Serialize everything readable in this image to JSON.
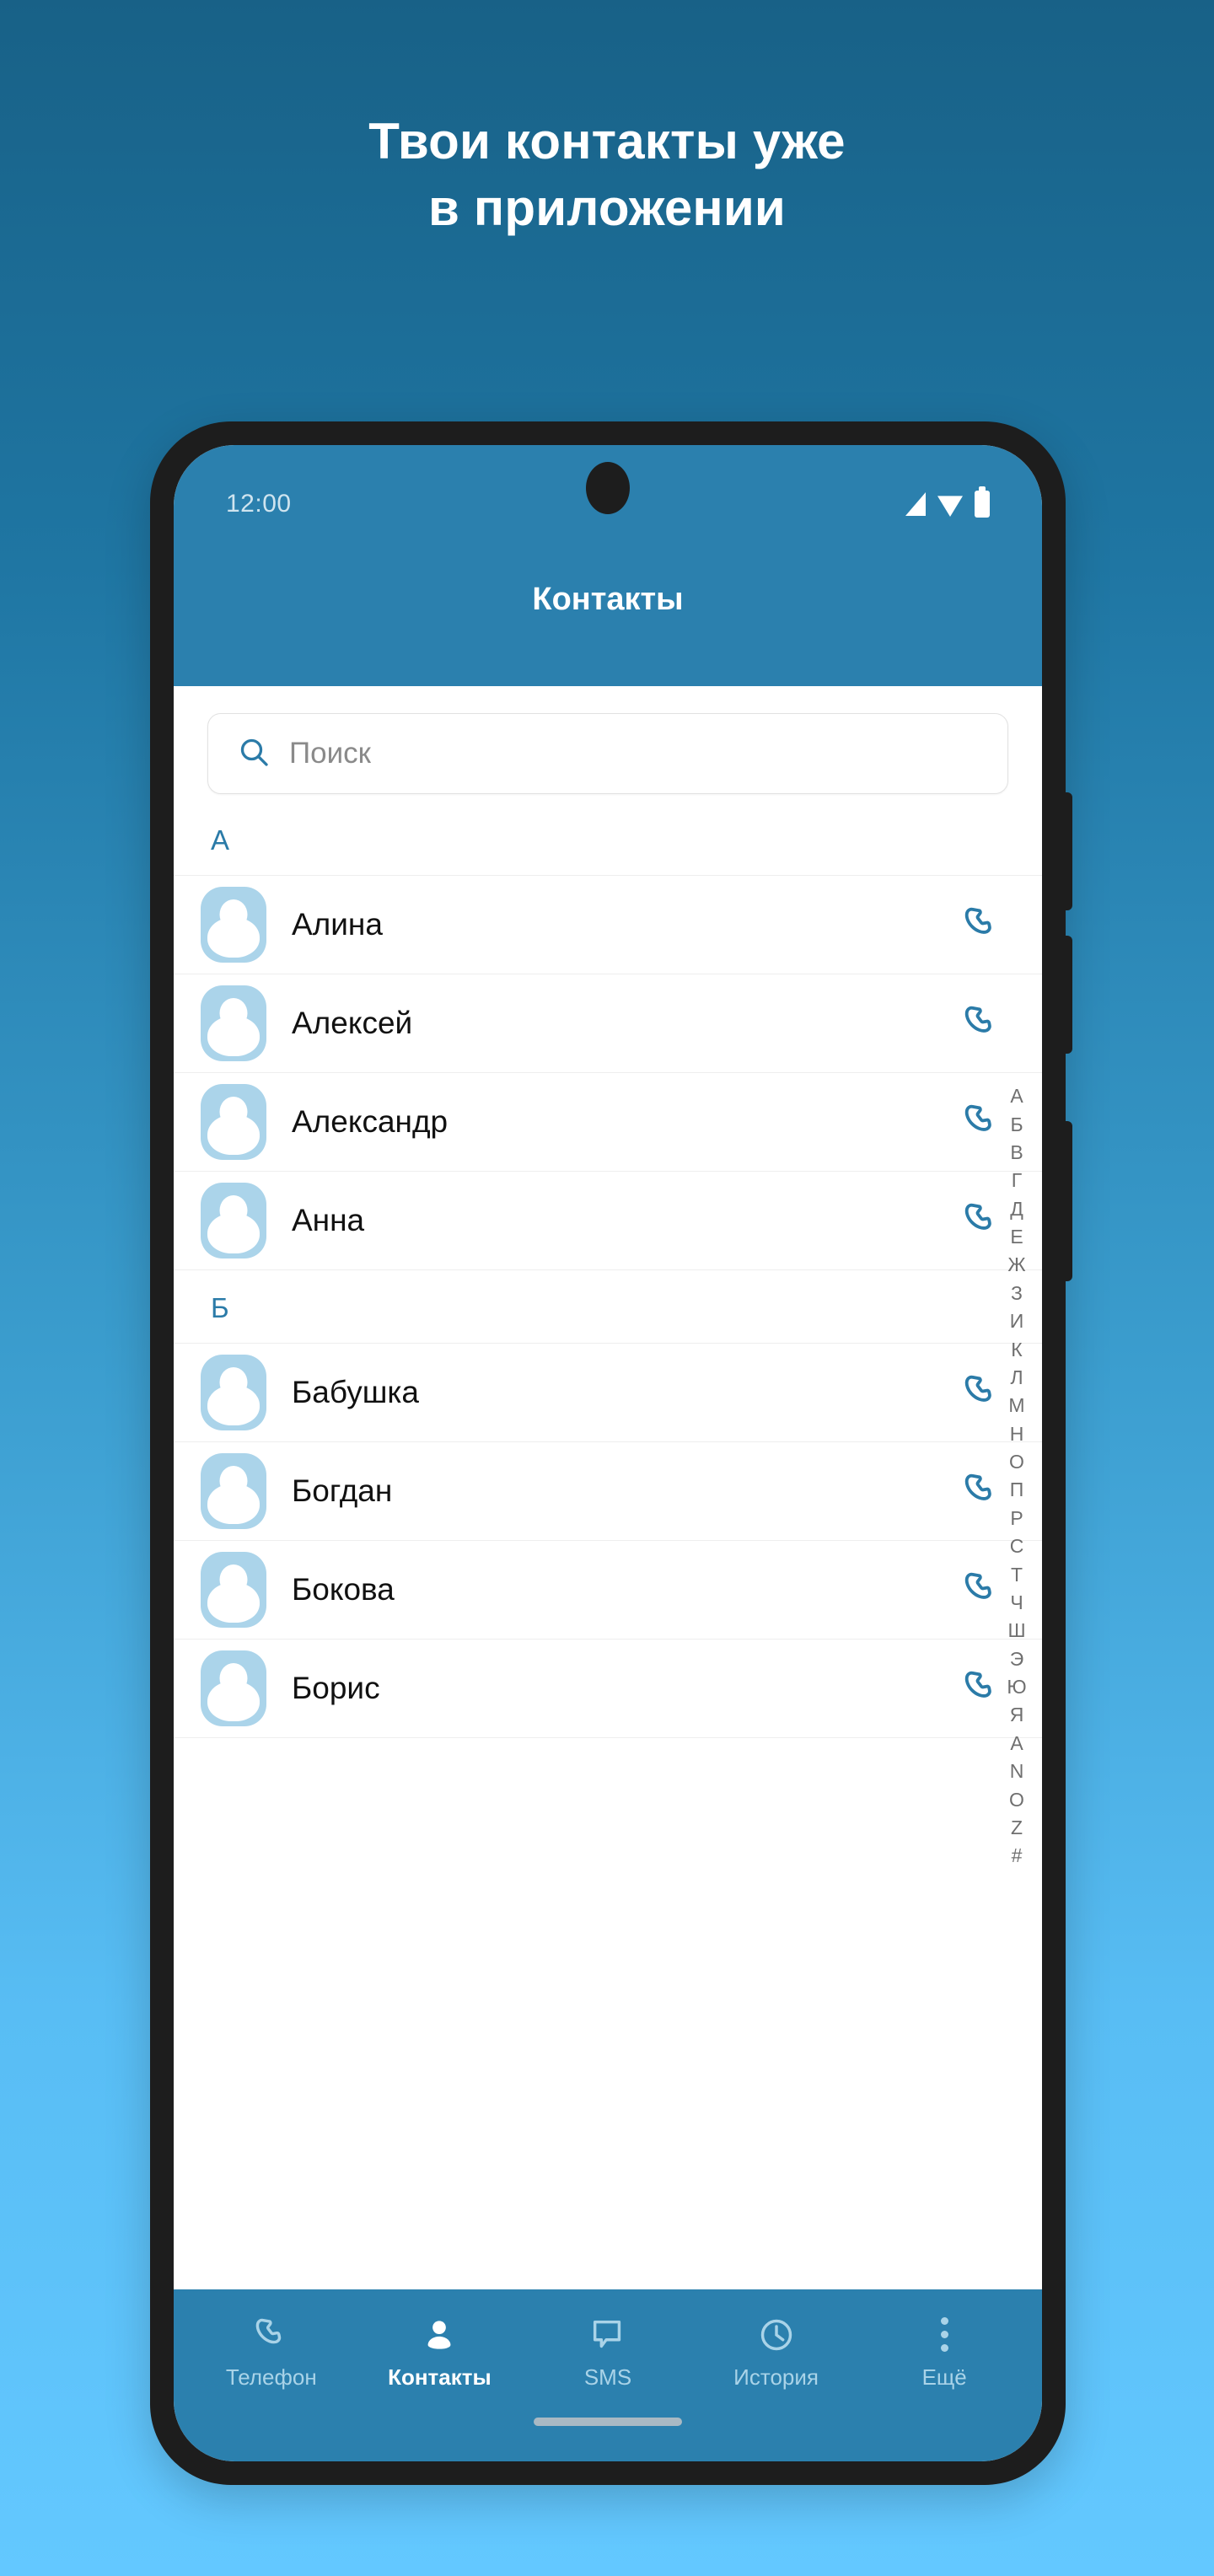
{
  "promo": {
    "line1": "Твои контакты уже",
    "line2": "в приложении"
  },
  "colors": {
    "brand_blue": "#2b80ae",
    "accent_blue": "#2b7ba8",
    "avatar_blue": "#abd4ea",
    "bg_top": "#186187",
    "bg_bottom": "#63c8ff"
  },
  "phone": {
    "status_bar": {
      "time": "12:00",
      "icons": [
        "signal-icon",
        "wifi-icon",
        "battery-icon"
      ]
    },
    "app_bar": {
      "title": "Контакты"
    },
    "search": {
      "placeholder": "Поиск",
      "value": "",
      "icon": "search-icon"
    },
    "sections": [
      {
        "letter": "А",
        "contacts": [
          {
            "name": "Алина",
            "avatar": "person-avatar",
            "action_icon": "phone-call-icon"
          },
          {
            "name": "Алексей",
            "avatar": "person-avatar",
            "action_icon": "phone-call-icon"
          },
          {
            "name": "Александр",
            "avatar": "person-avatar",
            "action_icon": "phone-call-icon"
          },
          {
            "name": "Анна",
            "avatar": "person-avatar",
            "action_icon": "phone-call-icon"
          }
        ]
      },
      {
        "letter": "Б",
        "contacts": [
          {
            "name": "Бабушка",
            "avatar": "person-avatar",
            "action_icon": "phone-call-icon"
          },
          {
            "name": "Богдан",
            "avatar": "person-avatar",
            "action_icon": "phone-call-icon"
          },
          {
            "name": "Бокова",
            "avatar": "person-avatar",
            "action_icon": "phone-call-icon"
          },
          {
            "name": "Борис",
            "avatar": "person-avatar",
            "action_icon": "phone-call-icon"
          }
        ]
      }
    ],
    "alpha_index": [
      "А",
      "Б",
      "В",
      "Г",
      "Д",
      "Е",
      "Ж",
      "З",
      "И",
      "К",
      "Л",
      "М",
      "Н",
      "О",
      "П",
      "Р",
      "С",
      "Т",
      "Ч",
      "Ш",
      "Э",
      "Ю",
      "Я",
      "A",
      "N",
      "O",
      "Z",
      "#"
    ],
    "bottom_nav": {
      "active": "Контакты",
      "items": [
        {
          "label": "Телефон",
          "icon": "phone-handset-icon"
        },
        {
          "label": "Контакты",
          "icon": "person-icon"
        },
        {
          "label": "SMS",
          "icon": "message-bubble-icon"
        },
        {
          "label": "История",
          "icon": "clock-icon"
        },
        {
          "label": "Ещё",
          "icon": "more-vertical-icon"
        }
      ]
    }
  }
}
